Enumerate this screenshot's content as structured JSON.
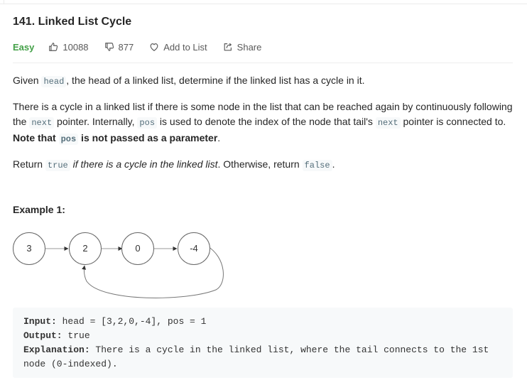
{
  "problem": {
    "title": "141. Linked List Cycle",
    "difficulty": "Easy",
    "likes": "10088",
    "dislikes": "877",
    "add_to_list": "Add to List",
    "share": "Share"
  },
  "colors": {
    "difficulty_easy": "#43a047",
    "text": "#262626",
    "code_text": "#546e7a",
    "code_bg": "#f7f9fa"
  },
  "icons": {
    "likes": "thumbs-up-icon",
    "dislikes": "thumbs-down-icon",
    "add_to_list": "heart-icon",
    "share": "share-icon"
  },
  "description": {
    "p1": {
      "code_head": "head",
      "text_after": ", the head of a linked list, determine if the linked list has a cycle in it.",
      "text_before": "Given "
    },
    "p2": {
      "t1": "There is a cycle in a linked list if there is some node in the list that can be reached again by continuously following the ",
      "c1": "next",
      "t2": " pointer. Internally, ",
      "c2": "pos",
      "t3": " is used to denote the index of the node that tail's ",
      "c3": "next",
      "t4": " pointer is connected to. ",
      "b1": "Note that ",
      "c4": "pos",
      "b2": " is not passed as a parameter",
      "t5": "."
    },
    "p3": {
      "t1": "Return ",
      "c1": "true",
      "i1": " if there is a cycle in the linked list",
      "t2": ". Otherwise, return ",
      "c2": "false",
      "t3": "."
    }
  },
  "example1": {
    "title": "Example 1:",
    "nodes": [
      "3",
      "2",
      "0",
      "-4"
    ],
    "input_label": "Input:",
    "input_value": " head = [3,2,0,-4], pos = 1",
    "output_label": "Output:",
    "output_value": " true",
    "explanation_label": "Explanation:",
    "explanation_value": " There is a cycle in the linked list, where the tail connects to the 1st node (0-indexed)."
  }
}
